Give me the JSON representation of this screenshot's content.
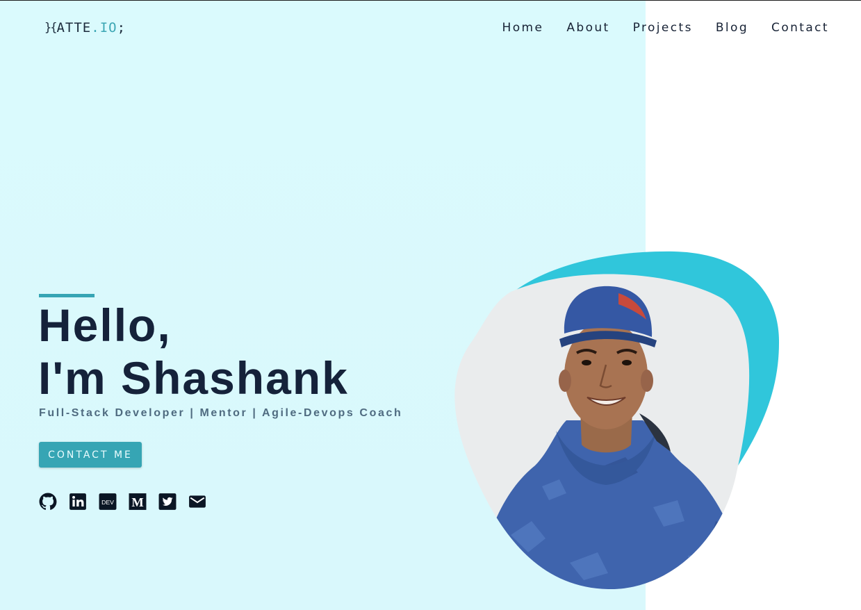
{
  "header": {
    "logo": {
      "bracket": "}{",
      "brand": "ATTE",
      "dot": ".",
      "tld": "IO",
      "semicolon": ";"
    },
    "nav": [
      {
        "label": "Home"
      },
      {
        "label": "About"
      },
      {
        "label": "Projects"
      },
      {
        "label": "Blog"
      },
      {
        "label": "Contact"
      }
    ]
  },
  "hero": {
    "greeting_line1": "Hello,",
    "greeting_line2": "I'm Shashank",
    "subtitle": "Full-Stack Developer | Mentor | Agile-Devops Coach",
    "cta_label": "CONTACT ME",
    "social_icons": [
      "github-icon",
      "linkedin-icon",
      "dev-icon",
      "medium-icon",
      "twitter-icon",
      "email-icon"
    ],
    "dev_icon_text": "DEV",
    "medium_icon_text": "M"
  },
  "colors": {
    "accent": "#36a5b4",
    "blob": "#30c6db",
    "panel_bg": "#dafafd",
    "heading": "#15223a",
    "subtitle": "#4f6b80"
  }
}
